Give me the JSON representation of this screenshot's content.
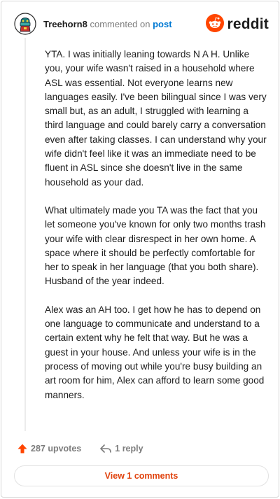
{
  "header": {
    "username": "Treehorn8",
    "action": "commented on",
    "post_link": "post",
    "logo_text": "reddit"
  },
  "comment": {
    "paragraphs": [
      "YTA. I was initially leaning towards N A H. Unlike you, your wife wasn't raised in a household where ASL was essential. Not everyone learns new languages easily. I've been bilingual since I was very small but, as an adult, I struggled with learning a third language and could barely carry a conversation even after taking classes. I can understand why your wife didn't feel like it was an immediate need to be fluent in ASL since she doesn't live in the same household as your dad.",
      "What ultimately made you TA was the fact that you let someone you've known for only two months trash your wife with clear disrespect in her own home. A space where it should be perfectly comfortable for her to speak in her language (that you both share). Husband of the year indeed.",
      "Alex was an AH too. I get how he has to depend on one language to communicate and understand to a certain extent why he felt that way. But he was a guest in your house. And unless your wife is in the process of moving out while you're busy building an art room for him, Alex can afford to learn some good manners."
    ]
  },
  "actions": {
    "upvotes": "287 upvotes",
    "reply": "1 reply",
    "view_comments": "View 1 comments"
  },
  "colors": {
    "accent": "#e0420d",
    "link": "#0079d3",
    "reddit_orange": "#ff4500",
    "muted": "#7c7c7c"
  },
  "icons": [
    "avatar",
    "reddit-logo-icon",
    "upvote-arrow-icon",
    "reply-arrow-icon"
  ]
}
